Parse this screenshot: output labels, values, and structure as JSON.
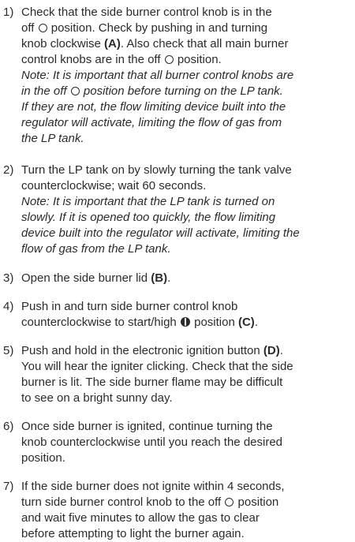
{
  "steps": [
    {
      "num": "1)",
      "lines": [
        "Check that the side burner control knob is in the",
        [
          "off ",
          {
            "sym": "off"
          },
          " position. Check by pushing in and turning"
        ],
        [
          "knob clockwise ",
          {
            "b": "(A)"
          },
          ". Also check that all main burner"
        ],
        [
          "control knobs are in the off ",
          {
            "sym": "off"
          },
          " position."
        ],
        {
          "i": "Note: It is important that all burner control knobs are"
        },
        [
          {
            "i": "in the off "
          },
          {
            "sym": "off"
          },
          {
            "i": " position before turning on the LP tank."
          }
        ],
        {
          "i": "If they are not, the flow limiting device built into the"
        },
        {
          "i": "regulator will activate, limiting the flow of gas from"
        },
        {
          "i": "the LP tank."
        }
      ]
    },
    {
      "num": "2)",
      "lines": [
        "Turn the LP tank on by slowly turning the tank valve",
        "counterclockwise; wait 60 seconds.",
        {
          "i": "Note: It is important that the LP tank is turned on"
        },
        {
          "i": "slowly. If it is opened too quickly, the flow limiting"
        },
        {
          "i": "device built into the regulator will activate, limiting the"
        },
        {
          "i": "flow of gas from the LP tank."
        }
      ]
    },
    {
      "num": "3)",
      "lines": [
        [
          "Open the side burner lid ",
          {
            "b": "(B)"
          },
          "."
        ]
      ]
    },
    {
      "num": "4)",
      "lines": [
        "Push in and turn side burner control knob",
        [
          "counterclockwise to start/high ",
          {
            "sym": "high"
          },
          " position ",
          {
            "b": "(C)"
          },
          "."
        ]
      ]
    },
    {
      "num": "5)",
      "lines": [
        [
          "Push and hold in the electronic ignition button ",
          {
            "b": "(D)"
          },
          "."
        ],
        "You will hear the igniter clicking. Check that the side",
        "burner is lit. The side burner flame may be difficult",
        "to see on a bright sunny day."
      ]
    },
    {
      "num": "6)",
      "lines": [
        "Once side burner is ignited, continue turning the",
        "knob counterclockwise until you reach the desired",
        "position."
      ]
    },
    {
      "num": "7)",
      "lines": [
        "If the side burner does not ignite within 4 seconds,",
        [
          "turn side burner control knob to the off ",
          {
            "sym": "off"
          },
          " position"
        ],
        "and wait five minutes to allow the gas to clear",
        "before attempting to light the burner again."
      ]
    }
  ]
}
